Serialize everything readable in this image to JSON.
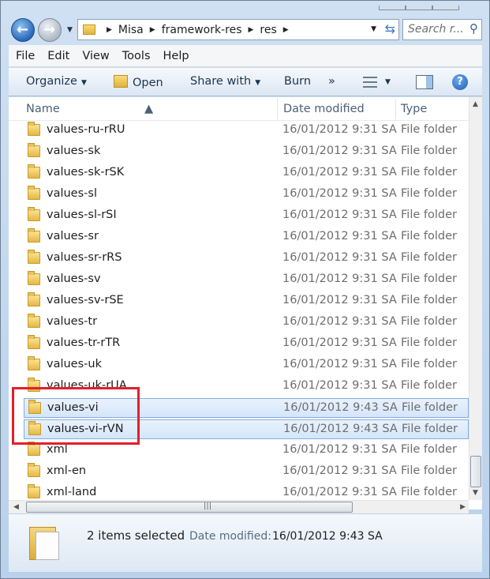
{
  "address": {
    "crumbs": [
      "Misa",
      "framework-res",
      "res"
    ],
    "search_placeholder": "Search r..."
  },
  "menu": [
    "File",
    "Edit",
    "View",
    "Tools",
    "Help"
  ],
  "commands": {
    "organize": "Organize",
    "open": "Open",
    "share_with": "Share with",
    "burn": "Burn",
    "more": "»"
  },
  "columns": {
    "name": "Name",
    "date": "Date modified",
    "type": "Type"
  },
  "rows": [
    {
      "name": "values-ru-rRU",
      "date": "16/01/2012 9:31 SA",
      "type": "File folder",
      "selected": false
    },
    {
      "name": "values-sk",
      "date": "16/01/2012 9:31 SA",
      "type": "File folder",
      "selected": false
    },
    {
      "name": "values-sk-rSK",
      "date": "16/01/2012 9:31 SA",
      "type": "File folder",
      "selected": false
    },
    {
      "name": "values-sl",
      "date": "16/01/2012 9:31 SA",
      "type": "File folder",
      "selected": false
    },
    {
      "name": "values-sl-rSI",
      "date": "16/01/2012 9:31 SA",
      "type": "File folder",
      "selected": false
    },
    {
      "name": "values-sr",
      "date": "16/01/2012 9:31 SA",
      "type": "File folder",
      "selected": false
    },
    {
      "name": "values-sr-rRS",
      "date": "16/01/2012 9:31 SA",
      "type": "File folder",
      "selected": false
    },
    {
      "name": "values-sv",
      "date": "16/01/2012 9:31 SA",
      "type": "File folder",
      "selected": false
    },
    {
      "name": "values-sv-rSE",
      "date": "16/01/2012 9:31 SA",
      "type": "File folder",
      "selected": false
    },
    {
      "name": "values-tr",
      "date": "16/01/2012 9:31 SA",
      "type": "File folder",
      "selected": false
    },
    {
      "name": "values-tr-rTR",
      "date": "16/01/2012 9:31 SA",
      "type": "File folder",
      "selected": false
    },
    {
      "name": "values-uk",
      "date": "16/01/2012 9:31 SA",
      "type": "File folder",
      "selected": false
    },
    {
      "name": "values-uk-rUA",
      "date": "16/01/2012 9:31 SA",
      "type": "File folder",
      "selected": false
    },
    {
      "name": "values-vi",
      "date": "16/01/2012 9:43 SA",
      "type": "File folder",
      "selected": true
    },
    {
      "name": "values-vi-rVN",
      "date": "16/01/2012 9:43 SA",
      "type": "File folder",
      "selected": true
    },
    {
      "name": "xml",
      "date": "16/01/2012 9:31 SA",
      "type": "File folder",
      "selected": false
    },
    {
      "name": "xml-en",
      "date": "16/01/2012 9:31 SA",
      "type": "File folder",
      "selected": false
    },
    {
      "name": "xml-land",
      "date": "16/01/2012 9:31 SA",
      "type": "File folder",
      "selected": false
    }
  ],
  "details": {
    "count": "2 items selected",
    "date_label": "Date modified:",
    "date_value": "16/01/2012 9:43 SA"
  },
  "colors": {
    "highlight_box": "#e0202b",
    "selection": "#d4e6fa"
  }
}
